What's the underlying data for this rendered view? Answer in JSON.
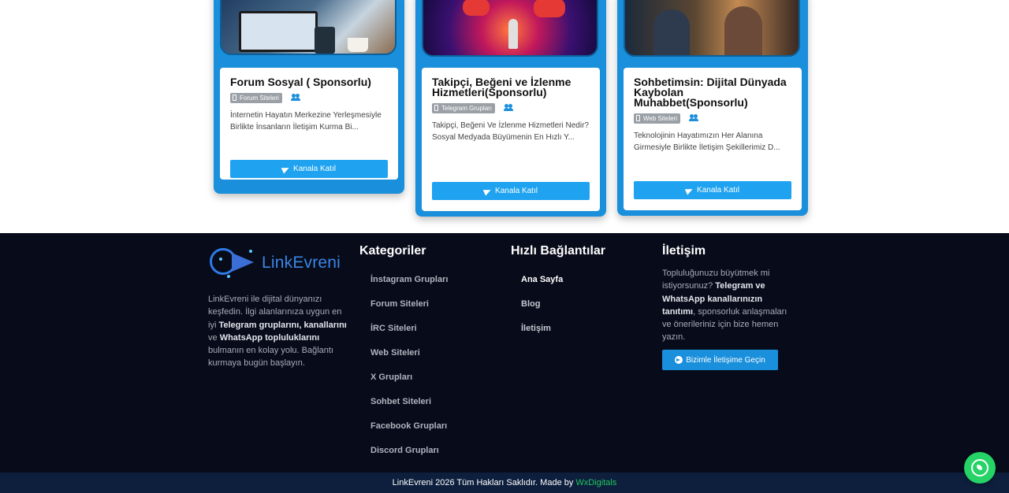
{
  "cards": [
    {
      "title": "Forum Sosyal ( Sponsorlu)",
      "category": "Forum Siteleri",
      "description": "İnternetin Hayatın Merkezine Yerleşmesiyle Birlikte İnsanların İletişim Kurma Bi...",
      "button_label": "Kanala Katıl"
    },
    {
      "title": "Takipçi, Beğeni ve İzlenme Hizmetleri(Sponsorlu)",
      "category": "Telegram Grupları",
      "description": "Takipçi, Beğeni Ve İzlenme Hizmetleri Nedir? Sosyal Medyada Büyümenin En Hızlı Y...",
      "button_label": "Kanala Katıl"
    },
    {
      "title": "Sohbetimsin: Dijital Dünyada Kaybolan Muhabbet(Sponsorlu)",
      "category": "Web Siteleri",
      "description": "Teknolojinin Hayatımızın Her Alanına Girmesiyle Birlikte İletişim Şekillerimiz D...",
      "button_label": "Kanala Katıl"
    }
  ],
  "footer": {
    "logo_text": "LinkEvreni",
    "about": {
      "part1": "LinkEvreni ile dijital dünyanızı keşfedin. İlgi alanlarınıza uygun en iyi ",
      "bold1": "Telegram gruplarını, kanallarını",
      "part2": " ve ",
      "bold2": "WhatsApp topluluklarını",
      "part3": " bulmanın en kolay yolu. Bağlantı kurmaya bugün başlayın."
    },
    "categories": {
      "heading": "Kategoriler",
      "items": [
        "İnstagram Grupları",
        "Forum Siteleri",
        "İRC Siteleri",
        "Web Siteleri",
        "X Grupları",
        "Sohbet Siteleri",
        "Facebook Grupları",
        "Discord Grupları"
      ]
    },
    "quick_links": {
      "heading": "Hızlı Bağlantılar",
      "items": [
        "Ana Sayfa",
        "Blog",
        "İletişim"
      ]
    },
    "contact": {
      "heading": "İletişim",
      "part1": "Topluluğunuzu büyütmek mi istiyorsunuz? ",
      "bold1": "Telegram ve WhatsApp kanallarınızın tanıtımı",
      "part2": ", sponsorluk anlaşmaları ve önerileriniz için bize hemen yazın.",
      "button_label": "Bizimle İletişime Geçin"
    },
    "copyright": "LinkEvreni 2026 Tüm Hakları Saklıdır. Made by",
    "made_by": "WxDigitals"
  },
  "icons": {
    "card_badge": "mobile-icon",
    "card_members": "users-icon",
    "card_button": "telegram-plane-icon",
    "contact_button": "telegram-circle-icon",
    "floating": "whatsapp-icon"
  },
  "colors": {
    "accent": "#1a8fdb",
    "button": "#1fa3f0",
    "footer_bg": "#070b1a",
    "bottom_bar_bg": "#0d1f3d",
    "brand_green": "#22c55e",
    "whatsapp": "#25d366"
  }
}
